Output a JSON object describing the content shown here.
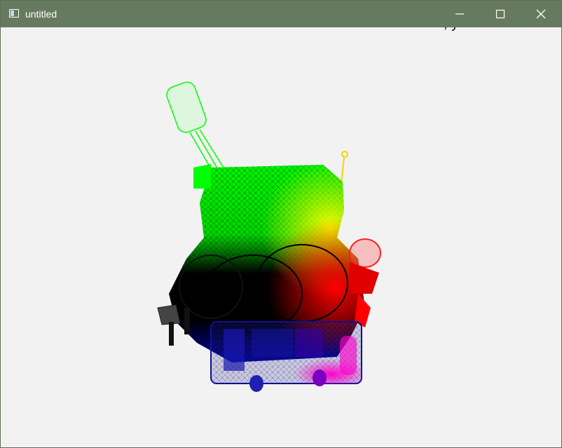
{
  "window": {
    "title": "untitled",
    "icon": "window-app-icon"
  },
  "controls": {
    "minimize": {
      "icon": "minimize-icon"
    },
    "maximize": {
      "icon": "maximize-icon"
    },
    "close": {
      "icon": "close-icon"
    }
  },
  "canvas": {
    "overlay_text": ", y"
  },
  "colors": {
    "titlebar": "#667a5f",
    "canvas": "#f2f2f2",
    "green": "#00ff00",
    "yellow": "#ffff00",
    "red": "#ff0000",
    "blue": "#1010a0",
    "magenta": "#ff00cc",
    "black": "#000000"
  }
}
